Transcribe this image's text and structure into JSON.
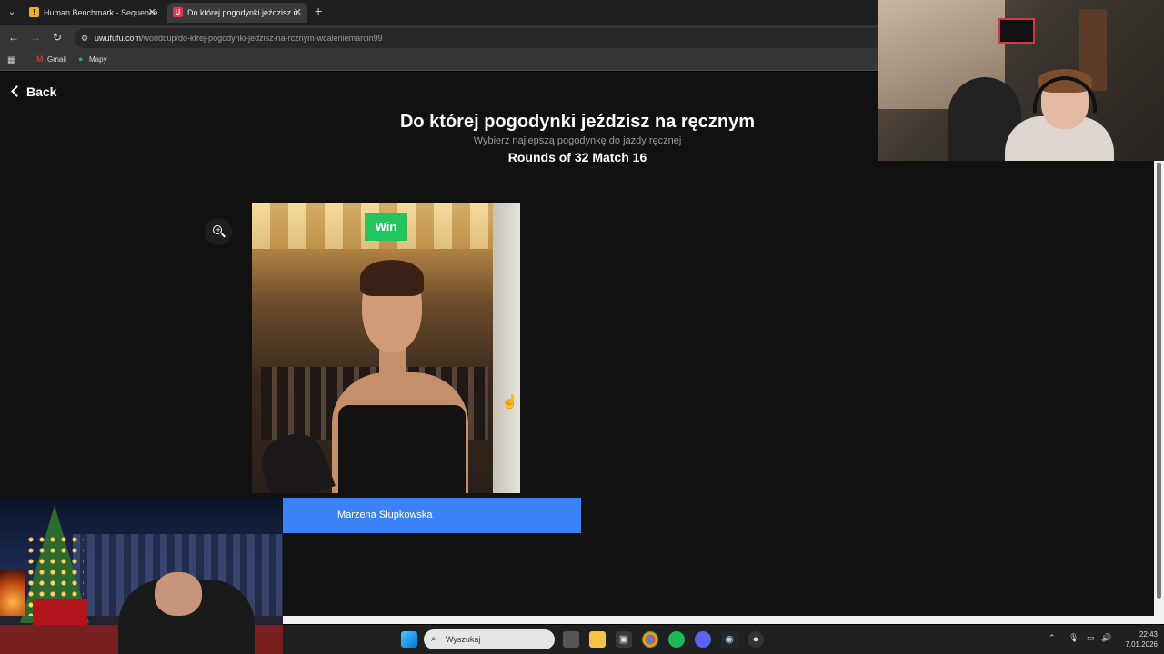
{
  "browser": {
    "tabs": [
      {
        "favicon": "Human Benchmark favicon",
        "title": "Human Benchmark - Sequence"
      },
      {
        "favicon": "uwufufu favicon",
        "title": "Do której pogodynki jeździsz n"
      }
    ],
    "url_host": "uwufufu.com",
    "url_path": "/worldcup/do-ktrej-pogodynki-jedzisz-na-rcznym-wcaleniemarcin99",
    "bookmarks": [
      {
        "label": "Gmail",
        "icon": "gmail-icon"
      },
      {
        "label": "Mapy",
        "icon": "maps-pin-icon"
      }
    ]
  },
  "page": {
    "back_label": "Back",
    "title": "Do której pogodynki jeździsz na ręcznym",
    "subtitle": "Wybierz najlepszą pogodynkę do jazdy ręcznej",
    "round_label": "Rounds of 32 Match 16",
    "candidate": {
      "badge": "Win",
      "name": "Marzena Słupkowska"
    },
    "colors": {
      "accent_blue": "#3b82f6",
      "win_green": "#22c55e"
    }
  },
  "taskbar": {
    "search_placeholder": "Wyszukaj",
    "time": "22:43",
    "date": "7.01.2026"
  }
}
